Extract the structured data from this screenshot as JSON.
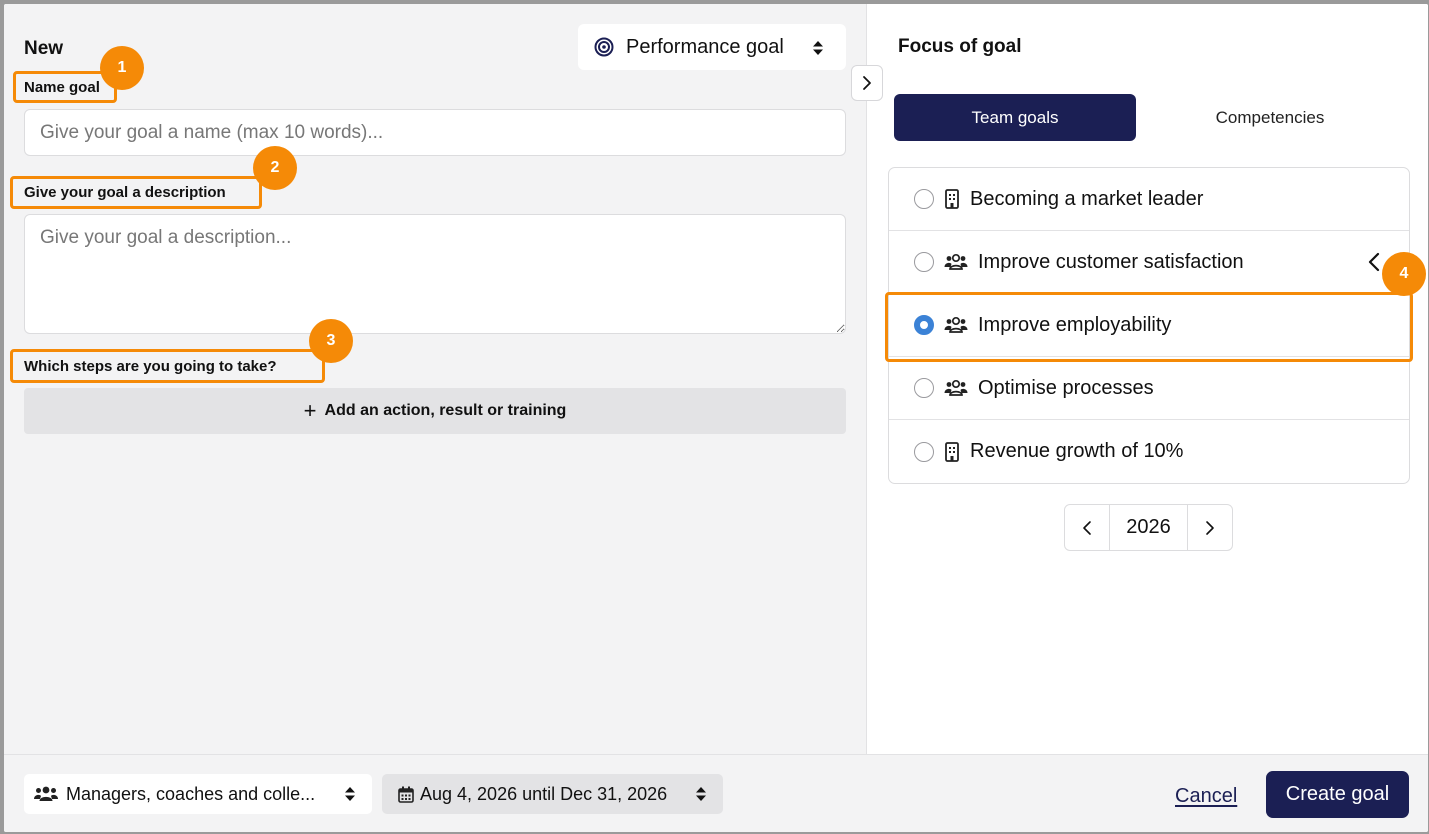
{
  "form": {
    "title": "New",
    "goal_type": "Performance goal",
    "name_label": "Name goal",
    "name_placeholder": "Give your goal a name (max 10 words)...",
    "name_value": "",
    "description_label": "Give your goal a description",
    "description_placeholder": "Give your goal a description...",
    "description_value": "",
    "steps_label": "Which steps are you going to take?",
    "add_step_label": "Add an action, result or training"
  },
  "focus": {
    "title": "Focus of goal",
    "tabs": [
      {
        "label": "Team goals",
        "active": true
      },
      {
        "label": "Competencies",
        "active": false
      }
    ],
    "goals": [
      {
        "label": "Becoming a market leader",
        "icon": "building-icon",
        "selected": false
      },
      {
        "label": "Improve customer satisfaction",
        "icon": "team-icon",
        "selected": false
      },
      {
        "label": "Improve employability",
        "icon": "team-icon",
        "selected": true
      },
      {
        "label": "Optimise processes",
        "icon": "team-icon",
        "selected": false
      },
      {
        "label": "Revenue growth of 10%",
        "icon": "building-icon",
        "selected": false
      }
    ],
    "year": "2026"
  },
  "footer": {
    "audience": "Managers, coaches and colle...",
    "date_range": "Aug 4, 2026 until Dec 31, 2026",
    "cancel_label": "Cancel",
    "create_label": "Create goal"
  },
  "annotations": [
    "1",
    "2",
    "3",
    "4"
  ],
  "colors": {
    "accent_navy": "#1b1f54",
    "highlight_orange": "#f58a07",
    "radio_blue": "#3b82d6"
  }
}
